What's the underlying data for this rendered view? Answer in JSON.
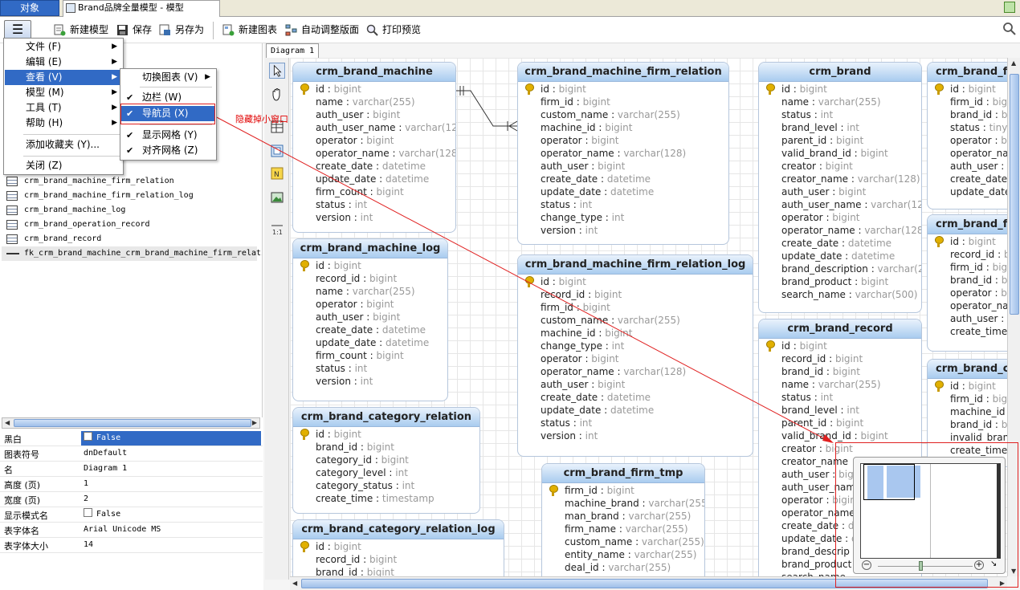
{
  "tabs": {
    "object": "对象",
    "model": "Brand品牌全量模型 - 模型"
  },
  "toolbar": {
    "new_model": "新建模型",
    "save": "保存",
    "save_as": "另存为",
    "new_diagram": "新建图表",
    "auto_layout": "自动调整版面",
    "print_preview": "打印预览"
  },
  "main_menu": {
    "items": [
      "文件 (F)",
      "编辑 (E)",
      "查看 (V)",
      "模型 (M)",
      "工具 (T)",
      "帮助 (H)"
    ],
    "add_favorite": "添加收藏夹 (Y)...",
    "close": "关闭 (Z)"
  },
  "view_submenu": {
    "switch_diagram": "切换图表 (V)",
    "sidebar": "边栏 (W)",
    "navigator": "导航员 (X)",
    "show_grid": "显示网格 (Y)",
    "align_grid": "对齐网格 (Z)"
  },
  "annotation": "隐藏掉小窗口",
  "object_list": [
    {
      "name": "crm_brand_machine_firm_relation",
      "kind": "table"
    },
    {
      "name": "crm_brand_machine_firm_relation_log",
      "kind": "table"
    },
    {
      "name": "crm_brand_machine_log",
      "kind": "table"
    },
    {
      "name": "crm_brand_operation_record",
      "kind": "table"
    },
    {
      "name": "crm_brand_record",
      "kind": "table"
    },
    {
      "name": "fk_crm_brand_machine_crm_brand_machine_firm_relati",
      "kind": "fk"
    }
  ],
  "properties": [
    {
      "key": "黑白",
      "value": "False",
      "checkbox": true
    },
    {
      "key": "图表符号",
      "value": "dnDefault"
    },
    {
      "key": "名",
      "value": "Diagram 1"
    },
    {
      "key": "高度 (页)",
      "value": "1"
    },
    {
      "key": "宽度 (页)",
      "value": "2"
    },
    {
      "key": "显示模式名",
      "value": "False",
      "checkbox": true
    },
    {
      "key": "表字体名",
      "value": "Arial Unicode MS"
    },
    {
      "key": "表字体大小",
      "value": "14"
    }
  ],
  "diagram_tab": "Diagram 1",
  "entities": {
    "crm_brand_machine": {
      "title": "crm_brand_machine",
      "fields": [
        [
          "id",
          "bigint"
        ],
        [
          "name",
          "varchar(255)"
        ],
        [
          "auth_user",
          "bigint"
        ],
        [
          "auth_user_name",
          "varchar(128)"
        ],
        [
          "operator",
          "bigint"
        ],
        [
          "operator_name",
          "varchar(128)"
        ],
        [
          "create_date",
          "datetime"
        ],
        [
          "update_date",
          "datetime"
        ],
        [
          "firm_count",
          "bigint"
        ],
        [
          "status",
          "int"
        ],
        [
          "version",
          "int"
        ]
      ]
    },
    "crm_brand_machine_firm_relation": {
      "title": "crm_brand_machine_firm_relation",
      "fields": [
        [
          "id",
          "bigint"
        ],
        [
          "firm_id",
          "bigint"
        ],
        [
          "custom_name",
          "varchar(255)"
        ],
        [
          "machine_id",
          "bigint"
        ],
        [
          "operator",
          "bigint"
        ],
        [
          "operator_name",
          "varchar(128)"
        ],
        [
          "auth_user",
          "bigint"
        ],
        [
          "create_date",
          "datetime"
        ],
        [
          "update_date",
          "datetime"
        ],
        [
          "status",
          "int"
        ],
        [
          "change_type",
          "int"
        ],
        [
          "version",
          "int"
        ]
      ]
    },
    "crm_brand": {
      "title": "crm_brand",
      "fields": [
        [
          "id",
          "bigint"
        ],
        [
          "name",
          "varchar(255)"
        ],
        [
          "status",
          "int"
        ],
        [
          "brand_level",
          "int"
        ],
        [
          "parent_id",
          "bigint"
        ],
        [
          "valid_brand_id",
          "bigint"
        ],
        [
          "creator",
          "bigint"
        ],
        [
          "creator_name",
          "varchar(128)"
        ],
        [
          "auth_user",
          "bigint"
        ],
        [
          "auth_user_name",
          "varchar(128)"
        ],
        [
          "operator",
          "bigint"
        ],
        [
          "operator_name",
          "varchar(128)"
        ],
        [
          "create_date",
          "datetime"
        ],
        [
          "update_date",
          "datetime"
        ],
        [
          "brand_description",
          "varchar(25..."
        ],
        [
          "brand_product",
          "bigint"
        ],
        [
          "search_name",
          "varchar(500)"
        ]
      ]
    },
    "crm_brand_f_a": {
      "title": "crm_brand_f",
      "fields": [
        [
          "id",
          "bigint"
        ],
        [
          "firm_id",
          "bigint"
        ],
        [
          "brand_id",
          "bigint"
        ],
        [
          "status",
          "tinyint"
        ],
        [
          "operator",
          "bigint"
        ],
        [
          "operator_nar",
          ""
        ],
        [
          "auth_user",
          "b"
        ],
        [
          "create_date",
          ""
        ],
        [
          "update_date",
          ""
        ]
      ]
    },
    "crm_brand_f_b": {
      "title": "crm_brand_f",
      "fields": [
        [
          "id",
          "bigint"
        ],
        [
          "record_id",
          "big"
        ],
        [
          "firm_id",
          "big"
        ],
        [
          "brand_id",
          "big"
        ],
        [
          "operator",
          "big"
        ],
        [
          "operator_nar",
          ""
        ],
        [
          "auth_user",
          "b"
        ],
        [
          "create_time",
          ""
        ]
      ]
    },
    "crm_brand_c": {
      "title": "crm_brand_c",
      "fields": [
        [
          "id",
          "bigint"
        ],
        [
          "firm_id",
          "bigint"
        ],
        [
          "machine_id",
          ""
        ],
        [
          "brand_id",
          "big"
        ],
        [
          "invalid_branc",
          ""
        ],
        [
          "create_time",
          ""
        ]
      ]
    },
    "crm_brand_machine_log": {
      "title": "crm_brand_machine_log",
      "fields": [
        [
          "id",
          "bigint"
        ],
        [
          "record_id",
          "bigint"
        ],
        [
          "name",
          "varchar(255)"
        ],
        [
          "operator",
          "bigint"
        ],
        [
          "auth_user",
          "bigint"
        ],
        [
          "create_date",
          "datetime"
        ],
        [
          "update_date",
          "datetime"
        ],
        [
          "firm_count",
          "bigint"
        ],
        [
          "status",
          "int"
        ],
        [
          "version",
          "int"
        ]
      ]
    },
    "crm_brand_machine_firm_relation_log": {
      "title": "crm_brand_machine_firm_relation_log",
      "fields": [
        [
          "id",
          "bigint"
        ],
        [
          "record_id",
          "bigint"
        ],
        [
          "firm_id",
          "bigint"
        ],
        [
          "custom_name",
          "varchar(255)"
        ],
        [
          "machine_id",
          "bigint"
        ],
        [
          "change_type",
          "int"
        ],
        [
          "operator",
          "bigint"
        ],
        [
          "operator_name",
          "varchar(128)"
        ],
        [
          "auth_user",
          "bigint"
        ],
        [
          "create_date",
          "datetime"
        ],
        [
          "update_date",
          "datetime"
        ],
        [
          "status",
          "int"
        ],
        [
          "version",
          "int"
        ]
      ]
    },
    "crm_brand_record": {
      "title": "crm_brand_record",
      "fields": [
        [
          "id",
          "bigint"
        ],
        [
          "record_id",
          "bigint"
        ],
        [
          "brand_id",
          "bigint"
        ],
        [
          "name",
          "varchar(255)"
        ],
        [
          "status",
          "int"
        ],
        [
          "brand_level",
          "int"
        ],
        [
          "parent_id",
          "bigint"
        ],
        [
          "valid_brand_id",
          "bigint"
        ],
        [
          "creator",
          "bigint"
        ],
        [
          "creator_name",
          ""
        ],
        [
          "auth_user",
          "bigint"
        ],
        [
          "auth_user_name",
          ""
        ],
        [
          "operator",
          "bigint"
        ],
        [
          "operator_name",
          ""
        ],
        [
          "create_date",
          "date"
        ],
        [
          "update_date",
          "da"
        ],
        [
          "brand_descrip",
          ""
        ],
        [
          "brand_product",
          ""
        ],
        [
          "search_name",
          ""
        ]
      ]
    },
    "crm_brand_category_relation": {
      "title": "crm_brand_category_relation",
      "fields": [
        [
          "id",
          "bigint"
        ],
        [
          "brand_id",
          "bigint"
        ],
        [
          "category_id",
          "bigint"
        ],
        [
          "category_level",
          "int"
        ],
        [
          "category_status",
          "int"
        ],
        [
          "create_time",
          "timestamp"
        ]
      ]
    },
    "crm_brand_firm_tmp": {
      "title": "crm_brand_firm_tmp",
      "fields": [
        [
          "firm_id",
          "bigint"
        ],
        [
          "machine_brand",
          "varchar(255)"
        ],
        [
          "man_brand",
          "varchar(255)"
        ],
        [
          "firm_name",
          "varchar(255)"
        ],
        [
          "custom_name",
          "varchar(255)"
        ],
        [
          "entity_name",
          "varchar(255)"
        ],
        [
          "deal_id",
          "varchar(255)"
        ]
      ]
    },
    "crm_brand_category_relation_log": {
      "title": "crm_brand_category_relation_log",
      "fields": [
        [
          "id",
          "bigint"
        ],
        [
          "record_id",
          "bigint"
        ],
        [
          "brand_id",
          "bigint"
        ]
      ]
    }
  },
  "navigator": {
    "zoom_percent": 45
  }
}
